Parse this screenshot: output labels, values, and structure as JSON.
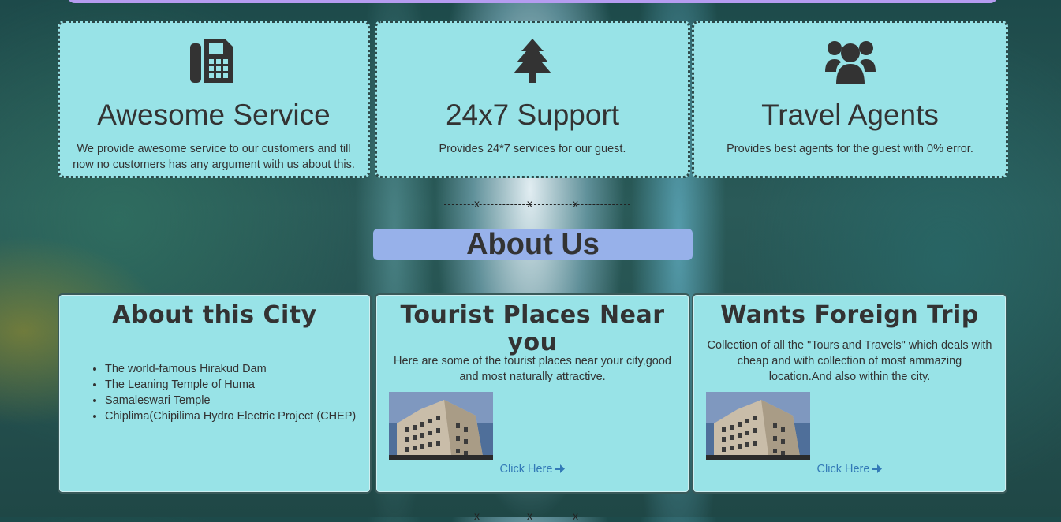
{
  "services": [
    {
      "icon": "fax-icon",
      "title": "Awesome Service",
      "text": "We provide awesome service to our customers and till now no customers has any argument with us about this."
    },
    {
      "icon": "tree-icon",
      "title": "24x7 Support",
      "text": "Provides 24*7 services for our guest."
    },
    {
      "icon": "users-icon",
      "title": "Travel Agents",
      "text": "Provides best agents for the guest with 0% error."
    }
  ],
  "divider_marks": [
    "x",
    "x",
    "x"
  ],
  "about_heading": "About Us",
  "about_city": {
    "title": "About this City",
    "items": [
      "The world-famous Hirakud Dam",
      "The Leaning Temple of Huma",
      "Samaleswari Temple",
      "Chiplima(Chipilima Hydro Electric Project (CHEP)"
    ]
  },
  "tourist": {
    "title": "Tourist Places Near you",
    "text": "Here are some of the tourist places near your city,good and most naturally attractive.",
    "link": "Click Here"
  },
  "foreign": {
    "title": "Wants Foreign Trip",
    "text": "Collection of all the \"Tours and Travels\" which deals with cheap and with collection of most ammazing location.And also within the city.",
    "link": "Click Here"
  },
  "colors": {
    "card_bg": "#98e3e7",
    "heading_bg": "#97b1ea",
    "top_strip": "#b59cf0",
    "link": "#337ab7",
    "text": "#333333"
  }
}
